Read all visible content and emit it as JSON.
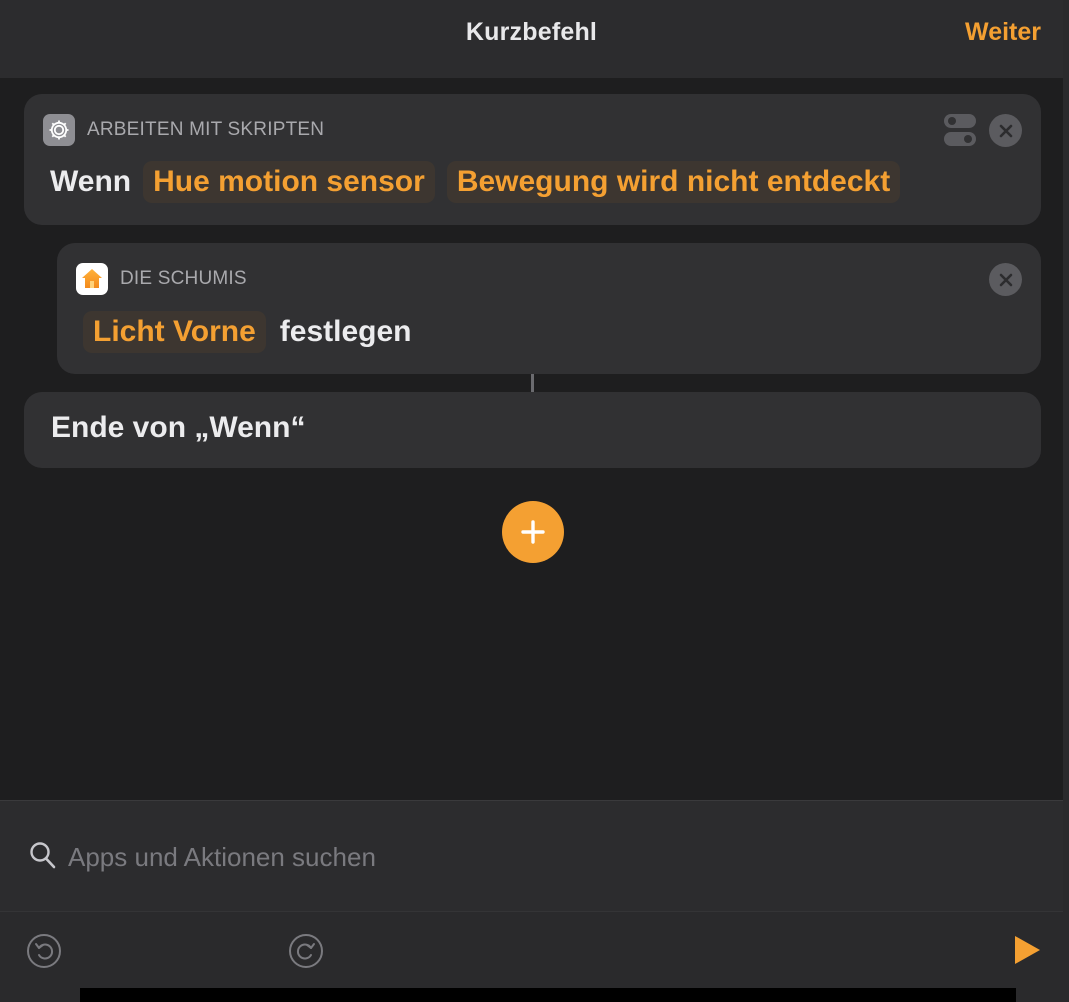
{
  "header": {
    "title": "Kurzbefehl",
    "next_label": "Weiter"
  },
  "actions": [
    {
      "category": "ARBEITEN MIT SKRIPTEN",
      "icon": "gear-icon",
      "keyword": "Wenn",
      "params": [
        "Hue motion sensor",
        "Bewegung wird nicht entdeckt"
      ]
    },
    {
      "category": "DIE SCHUMIS",
      "icon": "home-icon",
      "param": "Licht Vorne",
      "verb": "festlegen"
    },
    {
      "label": "Ende von „Wenn“"
    }
  ],
  "search": {
    "placeholder": "Apps und Aktionen suchen",
    "value": ""
  },
  "colors": {
    "accent": "#f4a032",
    "background": "#1e1e1f",
    "card": "#313133"
  }
}
